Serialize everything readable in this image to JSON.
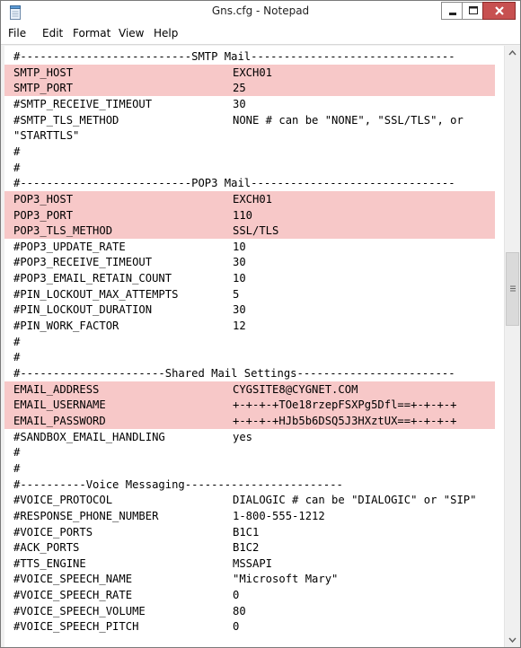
{
  "window": {
    "title": "Gns.cfg - Notepad",
    "icon": "notepad-icon"
  },
  "menu": [
    "File",
    "Edit",
    "Format",
    "View",
    "Help"
  ],
  "lines": [
    {
      "full": "#--------------------------SMTP Mail-------------------------------"
    },
    {
      "key": "SMTP_HOST",
      "value": "EXCH01",
      "highlight": true
    },
    {
      "key": "SMTP_PORT",
      "value": "25",
      "highlight": true
    },
    {
      "key": "#SMTP_RECEIVE_TIMEOUT",
      "value": "30"
    },
    {
      "key": "#SMTP_TLS_METHOD",
      "value": "NONE # can be \"NONE\", \"SSL/TLS\", or"
    },
    {
      "full": "\"STARTTLS\""
    },
    {
      "full": "#"
    },
    {
      "full": "#"
    },
    {
      "full": "#--------------------------POP3 Mail-------------------------------"
    },
    {
      "key": "POP3_HOST",
      "value": "EXCH01",
      "highlight": true
    },
    {
      "key": "POP3_PORT",
      "value": "110",
      "highlight": true
    },
    {
      "key": "POP3_TLS_METHOD",
      "value": "SSL/TLS",
      "highlight": true
    },
    {
      "key": "#POP3_UPDATE_RATE",
      "value": "10"
    },
    {
      "key": "#POP3_RECEIVE_TIMEOUT",
      "value": "30"
    },
    {
      "key": "#POP3_EMAIL_RETAIN_COUNT",
      "value": "10"
    },
    {
      "key": "#PIN_LOCKOUT_MAX_ATTEMPTS",
      "value": "5"
    },
    {
      "key": "#PIN_LOCKOUT_DURATION",
      "value": "30"
    },
    {
      "key": "#PIN_WORK_FACTOR",
      "value": "12"
    },
    {
      "full": "#"
    },
    {
      "full": "#"
    },
    {
      "full": "#----------------------Shared Mail Settings------------------------"
    },
    {
      "key": "EMAIL_ADDRESS",
      "value": "CYGSITE8@CYGNET.COM",
      "highlight": true
    },
    {
      "key": "EMAIL_USERNAME",
      "value": "+-+-+-+TOe18rzepFSXPg5Dfl==+-+-+-+",
      "highlight": true
    },
    {
      "key": "EMAIL_PASSWORD",
      "value": "+-+-+-+HJb5b6DSQ5J3HXztUX==+-+-+-+",
      "highlight": true
    },
    {
      "key": "#SANDBOX_EMAIL_HANDLING",
      "value": "yes"
    },
    {
      "full": "#"
    },
    {
      "full": "#"
    },
    {
      "full": "#----------Voice Messaging------------------------"
    },
    {
      "key": "#VOICE_PROTOCOL",
      "value": "DIALOGIC # can be \"DIALOGIC\" or \"SIP\""
    },
    {
      "key": "#RESPONSE_PHONE_NUMBER",
      "value": "1-800-555-1212"
    },
    {
      "key": "#VOICE_PORTS",
      "value": "B1C1"
    },
    {
      "key": "#ACK_PORTS",
      "value": "B1C2"
    },
    {
      "key": "#TTS_ENGINE",
      "value": "MSSAPI"
    },
    {
      "key": "#VOICE_SPEECH_NAME",
      "value": "\"Microsoft Mary\""
    },
    {
      "key": "#VOICE_SPEECH_RATE",
      "value": "0"
    },
    {
      "key": "#VOICE_SPEECH_VOLUME",
      "value": "80"
    },
    {
      "key": "#VOICE_SPEECH_PITCH",
      "value": "0"
    }
  ],
  "colors": {
    "highlight": "#f7c8c8",
    "close_button": "#c75050"
  }
}
